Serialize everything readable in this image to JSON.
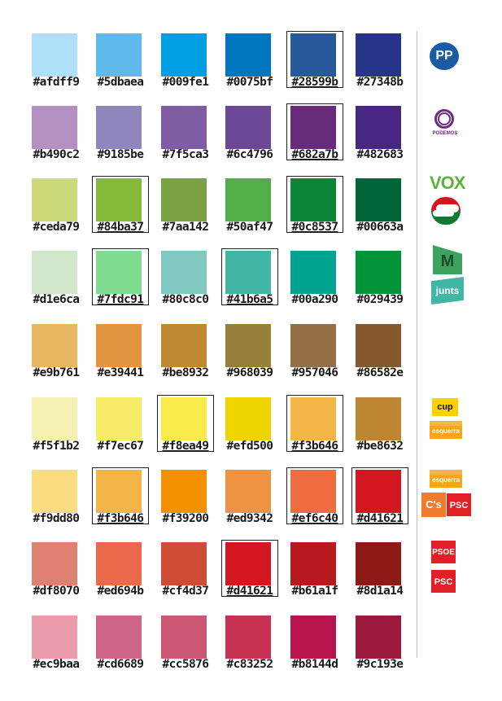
{
  "rows": [
    [
      {
        "hex": "#afdff9",
        "boxed": false
      },
      {
        "hex": "#5dbaea",
        "boxed": false
      },
      {
        "hex": "#009fe1",
        "boxed": false
      },
      {
        "hex": "#0075bf",
        "boxed": false
      },
      {
        "hex": "#28599b",
        "boxed": true
      },
      {
        "hex": "#27348b",
        "boxed": false
      }
    ],
    [
      {
        "hex": "#b490c2",
        "boxed": false
      },
      {
        "hex": "#9185be",
        "boxed": false
      },
      {
        "hex": "#7f5ca3",
        "boxed": false
      },
      {
        "hex": "#6c4796",
        "boxed": false
      },
      {
        "hex": "#682a7b",
        "boxed": true
      },
      {
        "hex": "#482683",
        "boxed": false
      }
    ],
    [
      {
        "hex": "#ceda79",
        "boxed": false
      },
      {
        "hex": "#84ba37",
        "boxed": true
      },
      {
        "hex": "#7aa142",
        "boxed": false
      },
      {
        "hex": "#50af47",
        "boxed": false
      },
      {
        "hex": "#0c8537",
        "boxed": true
      },
      {
        "hex": "#00663a",
        "boxed": false
      }
    ],
    [
      {
        "hex": "#d1e6ca",
        "boxed": false
      },
      {
        "hex": "#7fdc91",
        "boxed": true
      },
      {
        "hex": "#80c8c0",
        "boxed": false
      },
      {
        "hex": "#41b6a5",
        "boxed": true
      },
      {
        "hex": "#00a290",
        "boxed": false
      },
      {
        "hex": "#029439",
        "boxed": false
      }
    ],
    [
      {
        "hex": "#e9b761",
        "boxed": false
      },
      {
        "hex": "#e39441",
        "boxed": false
      },
      {
        "hex": "#be8932",
        "boxed": false
      },
      {
        "hex": "#968039",
        "boxed": false
      },
      {
        "hex": "#957046",
        "boxed": false
      },
      {
        "hex": "#86582e",
        "boxed": false
      }
    ],
    [
      {
        "hex": "#f5f1b2",
        "boxed": false
      },
      {
        "hex": "#f7ec67",
        "boxed": false
      },
      {
        "hex": "#f8ea49",
        "boxed": true
      },
      {
        "hex": "#efd500",
        "boxed": false
      },
      {
        "hex": "#f3b646",
        "boxed": true
      },
      {
        "hex": "#be8632",
        "boxed": false
      }
    ],
    [
      {
        "hex": "#f9dd80",
        "boxed": false
      },
      {
        "hex": "#f3b646",
        "boxed": true
      },
      {
        "hex": "#f39200",
        "boxed": false
      },
      {
        "hex": "#ed9342",
        "boxed": false
      },
      {
        "hex": "#ef6c40",
        "boxed": true
      },
      {
        "hex": "#d41621",
        "boxed": true
      }
    ],
    [
      {
        "hex": "#df8070",
        "boxed": false
      },
      {
        "hex": "#ed694b",
        "boxed": false
      },
      {
        "hex": "#cf4d37",
        "boxed": false
      },
      {
        "hex": "#d41621",
        "boxed": true
      },
      {
        "hex": "#b61a1f",
        "boxed": false
      },
      {
        "hex": "#8d1a14",
        "boxed": false
      }
    ],
    [
      {
        "hex": "#ec9baa",
        "boxed": false
      },
      {
        "hex": "#cd6689",
        "boxed": false
      },
      {
        "hex": "#cc5876",
        "boxed": false
      },
      {
        "hex": "#c83252",
        "boxed": false
      },
      {
        "hex": "#b8144d",
        "boxed": false
      },
      {
        "hex": "#9c193e",
        "boxed": false
      }
    ]
  ],
  "logos": {
    "pp": "PP",
    "podemos": "PODEMOS",
    "vox": "VOX",
    "mes": "M",
    "junts": "junts",
    "cup": "cup",
    "esquerra": "esquerra",
    "cs": "C's",
    "psc": "PSC",
    "psoe": "PSOE"
  },
  "colors": {
    "pp": "#1b5ba6",
    "podemos": "#6c2a83",
    "vox": "#5ab43b",
    "junts": "#3fb6a6",
    "cup": "#fdd000",
    "esquerra": "#f7a51c",
    "cs": "#ee7c2c",
    "psc": "#e21f26"
  }
}
